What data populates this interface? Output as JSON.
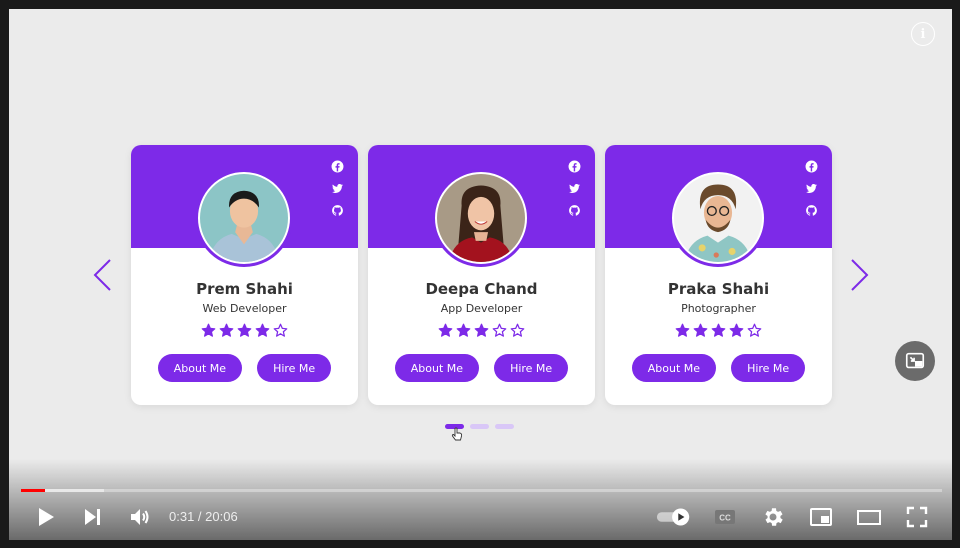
{
  "cards": [
    {
      "name": "Prem Shahi",
      "role": "Web Developer",
      "rating": 4,
      "max_rating": 5,
      "about_label": "About Me",
      "hire_label": "Hire Me"
    },
    {
      "name": "Deepa Chand",
      "role": "App Developer",
      "rating": 3,
      "max_rating": 5,
      "about_label": "About Me",
      "hire_label": "Hire Me"
    },
    {
      "name": "Praka Shahi",
      "role": "Photographer",
      "rating": 4,
      "max_rating": 5,
      "about_label": "About Me",
      "hire_label": "Hire Me"
    }
  ],
  "socials": [
    "facebook-icon",
    "twitter-icon",
    "github-icon"
  ],
  "pagination": {
    "total": 3,
    "active": 1
  },
  "colors": {
    "accent": "#7d2ae8",
    "accent_light": "#d9c7f7",
    "background": "#ebebeb",
    "progress": "#ff0000"
  },
  "player": {
    "current_time": "0:31",
    "separator": " / ",
    "duration": "20:06",
    "progress": 0.026,
    "buffered": 0.09,
    "autoplay": true
  }
}
